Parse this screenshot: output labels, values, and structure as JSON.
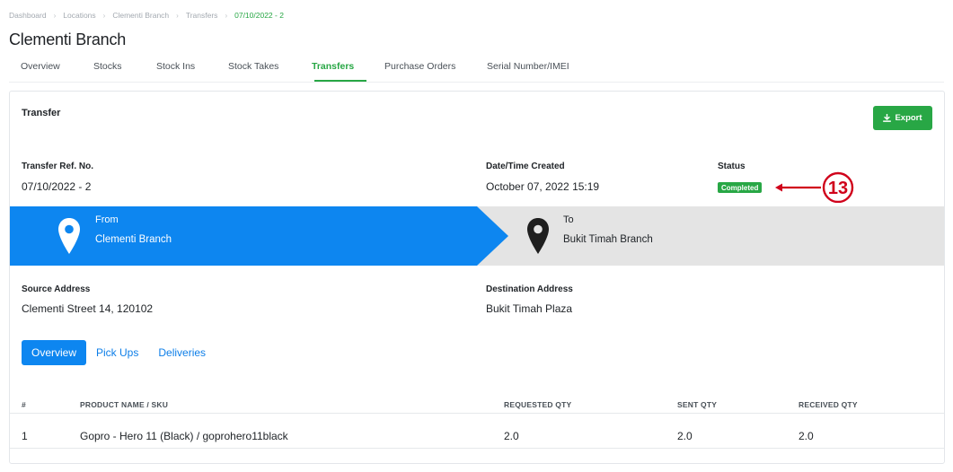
{
  "breadcrumb": {
    "items": [
      "Dashboard",
      "Locations",
      "Clementi Branch",
      "Transfers",
      "07/10/2022 - 2"
    ],
    "separator": "›"
  },
  "page": {
    "title": "Clementi Branch"
  },
  "tabs": [
    {
      "label": "Overview"
    },
    {
      "label": "Stocks"
    },
    {
      "label": "Stock Ins"
    },
    {
      "label": "Stock Takes"
    },
    {
      "label": "Transfers",
      "active": true
    },
    {
      "label": "Purchase Orders"
    },
    {
      "label": "Serial Number/IMEI"
    }
  ],
  "card": {
    "title": "Transfer",
    "export_label": "Export",
    "export_icon": "download-icon"
  },
  "details": {
    "ref_label": "Transfer Ref. No.",
    "ref_value": "07/10/2022 - 2",
    "date_label": "Date/Time Created",
    "date_value": "October 07, 2022 15:19",
    "status_label": "Status",
    "status_value": "Completed",
    "annotation_number": "13"
  },
  "route": {
    "from_label": "From",
    "from_name": "Clementi Branch",
    "to_label": "To",
    "to_name": "Bukit Timah Branch"
  },
  "addresses": {
    "source_label": "Source Address",
    "source_value": "Clementi Street 14, 120102",
    "destination_label": "Destination Address",
    "destination_value": "Bukit Timah Plaza"
  },
  "subtabs": [
    {
      "label": "Overview",
      "active": true
    },
    {
      "label": "Pick Ups"
    },
    {
      "label": "Deliveries"
    }
  ],
  "table": {
    "headers": [
      "#",
      "PRODUCT NAME / SKU",
      "REQUESTED QTY",
      "SENT QTY",
      "RECEIVED QTY"
    ],
    "rows": [
      [
        "1",
        "Gopro - Hero 11 (Black) / goprohero11black",
        "2.0",
        "2.0",
        "2.0"
      ]
    ]
  },
  "colors": {
    "accent_green": "#28a745",
    "accent_blue": "#0d86f0",
    "annotation_red": "#d0021b",
    "route_gray": "#e4e4e4"
  }
}
